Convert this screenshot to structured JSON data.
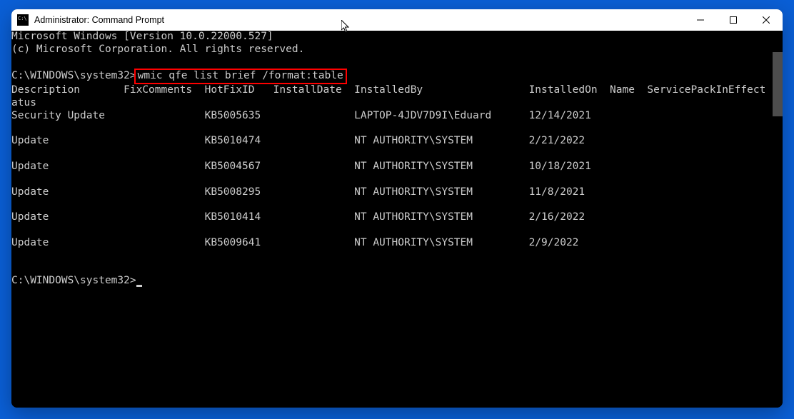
{
  "window": {
    "title": "Administrator: Command Prompt"
  },
  "terminal": {
    "header_line1": "Microsoft Windows [Version 10.0.22000.527]",
    "header_line2": "(c) Microsoft Corporation. All rights reserved.",
    "prompt1": "C:\\WINDOWS\\system32>",
    "command": "wmic qfe list brief /format:table",
    "columns_line": "Description       FixComments  HotFixID   InstallDate  InstalledBy                 InstalledOn  Name  ServicePackInEffect  St",
    "columns_line2": "atus",
    "rows": [
      {
        "Description": "Security Update",
        "HotFixID": "KB5005635",
        "InstalledBy": "LAPTOP-4JDV7D9I\\Eduard",
        "InstalledOn": "12/14/2021"
      },
      {
        "Description": "Update",
        "HotFixID": "KB5010474",
        "InstalledBy": "NT AUTHORITY\\SYSTEM",
        "InstalledOn": "2/21/2022"
      },
      {
        "Description": "Update",
        "HotFixID": "KB5004567",
        "InstalledBy": "NT AUTHORITY\\SYSTEM",
        "InstalledOn": "10/18/2021"
      },
      {
        "Description": "Update",
        "HotFixID": "KB5008295",
        "InstalledBy": "NT AUTHORITY\\SYSTEM",
        "InstalledOn": "11/8/2021"
      },
      {
        "Description": "Update",
        "HotFixID": "KB5010414",
        "InstalledBy": "NT AUTHORITY\\SYSTEM",
        "InstalledOn": "2/16/2022"
      },
      {
        "Description": "Update",
        "HotFixID": "KB5009641",
        "InstalledBy": "NT AUTHORITY\\SYSTEM",
        "InstalledOn": "2/9/2022"
      }
    ],
    "prompt2": "C:\\WINDOWS\\system32>"
  }
}
